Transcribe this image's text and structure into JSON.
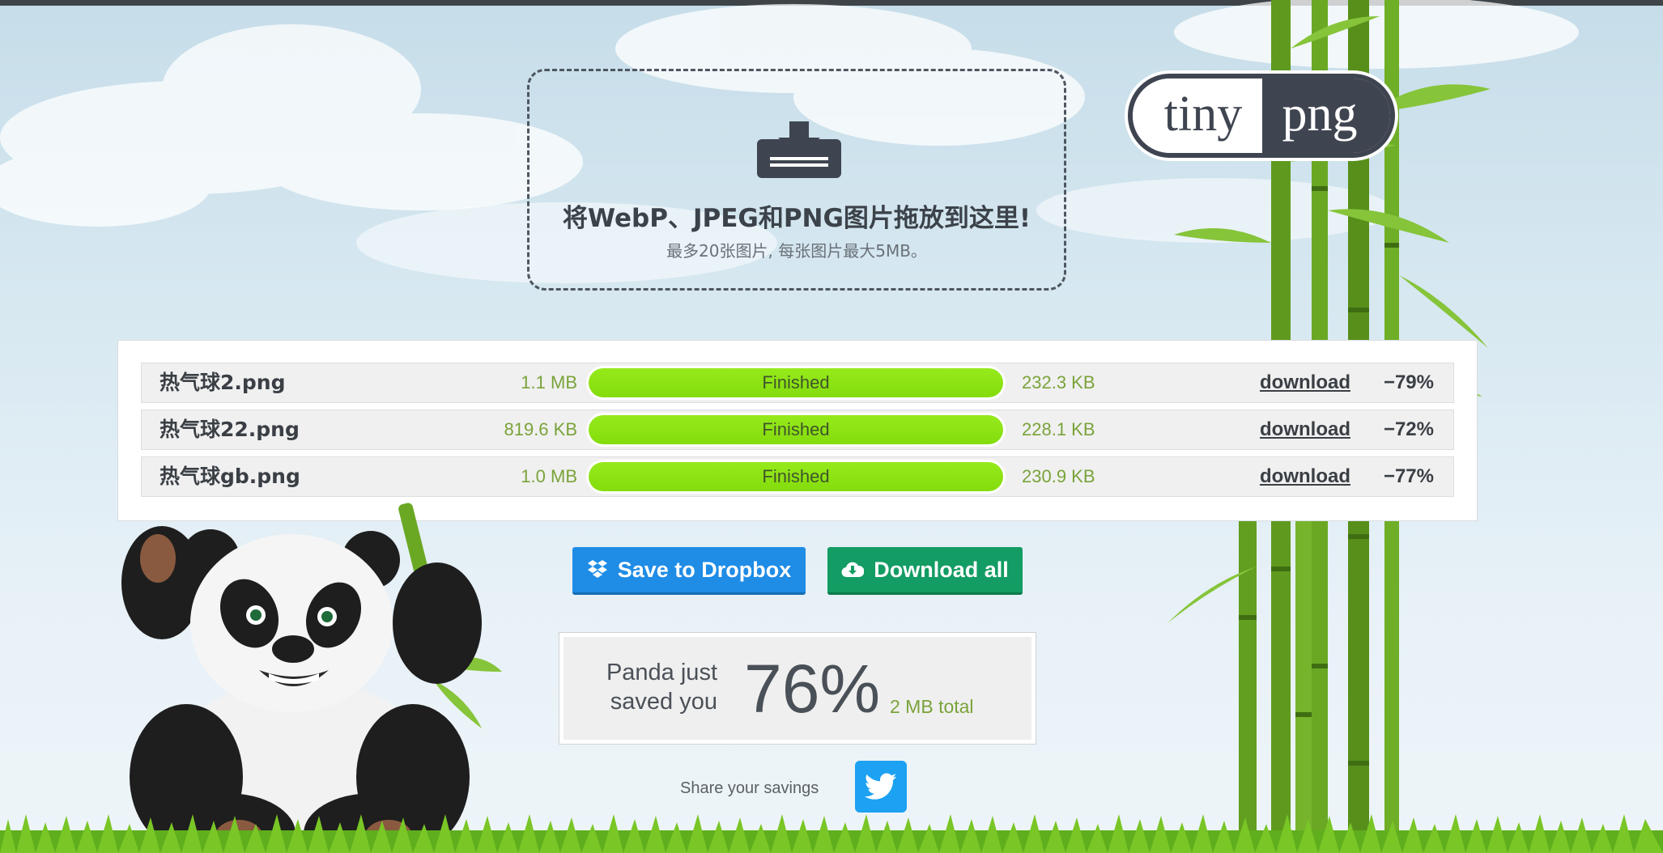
{
  "dropzone": {
    "title": "将WebP、JPEG和PNG图片拖放到这里!",
    "subtitle": "最多20张图片, 每张图片最大5MB。"
  },
  "logo": {
    "left": "tiny",
    "right": "png"
  },
  "files": [
    {
      "name": "热气球2.png",
      "original_size": "1.1 MB",
      "status": "Finished",
      "progress": 1.0,
      "new_size": "232.3 KB",
      "download_label": "download",
      "savings": "−79%"
    },
    {
      "name": "热气球22.png",
      "original_size": "819.6 KB",
      "status": "Finished",
      "progress": 1.0,
      "new_size": "228.1 KB",
      "download_label": "download",
      "savings": "−72%"
    },
    {
      "name": "热气球gb.png",
      "original_size": "1.0 MB",
      "status": "Finished",
      "progress": 1.0,
      "new_size": "230.9 KB",
      "download_label": "download",
      "savings": "−77%"
    }
  ],
  "actions": {
    "dropbox_label": "Save to Dropbox",
    "download_all_label": "Download all"
  },
  "summary": {
    "line1": "Panda just",
    "line2": "saved you",
    "percent": "76%",
    "total": "2 MB total"
  },
  "share": {
    "label": "Share your savings"
  },
  "colors": {
    "accent_green": "#84dc0c",
    "size_text": "#7aa33a",
    "dropbox_blue": "#1f8ce6",
    "download_green": "#139c63",
    "twitter_blue": "#1da1f2",
    "dark": "#3f4550"
  },
  "icons": {
    "upload": "tray-download-icon",
    "dropbox": "dropbox-icon",
    "download_all": "cloud-download-icon",
    "twitter": "twitter-bird-icon"
  }
}
